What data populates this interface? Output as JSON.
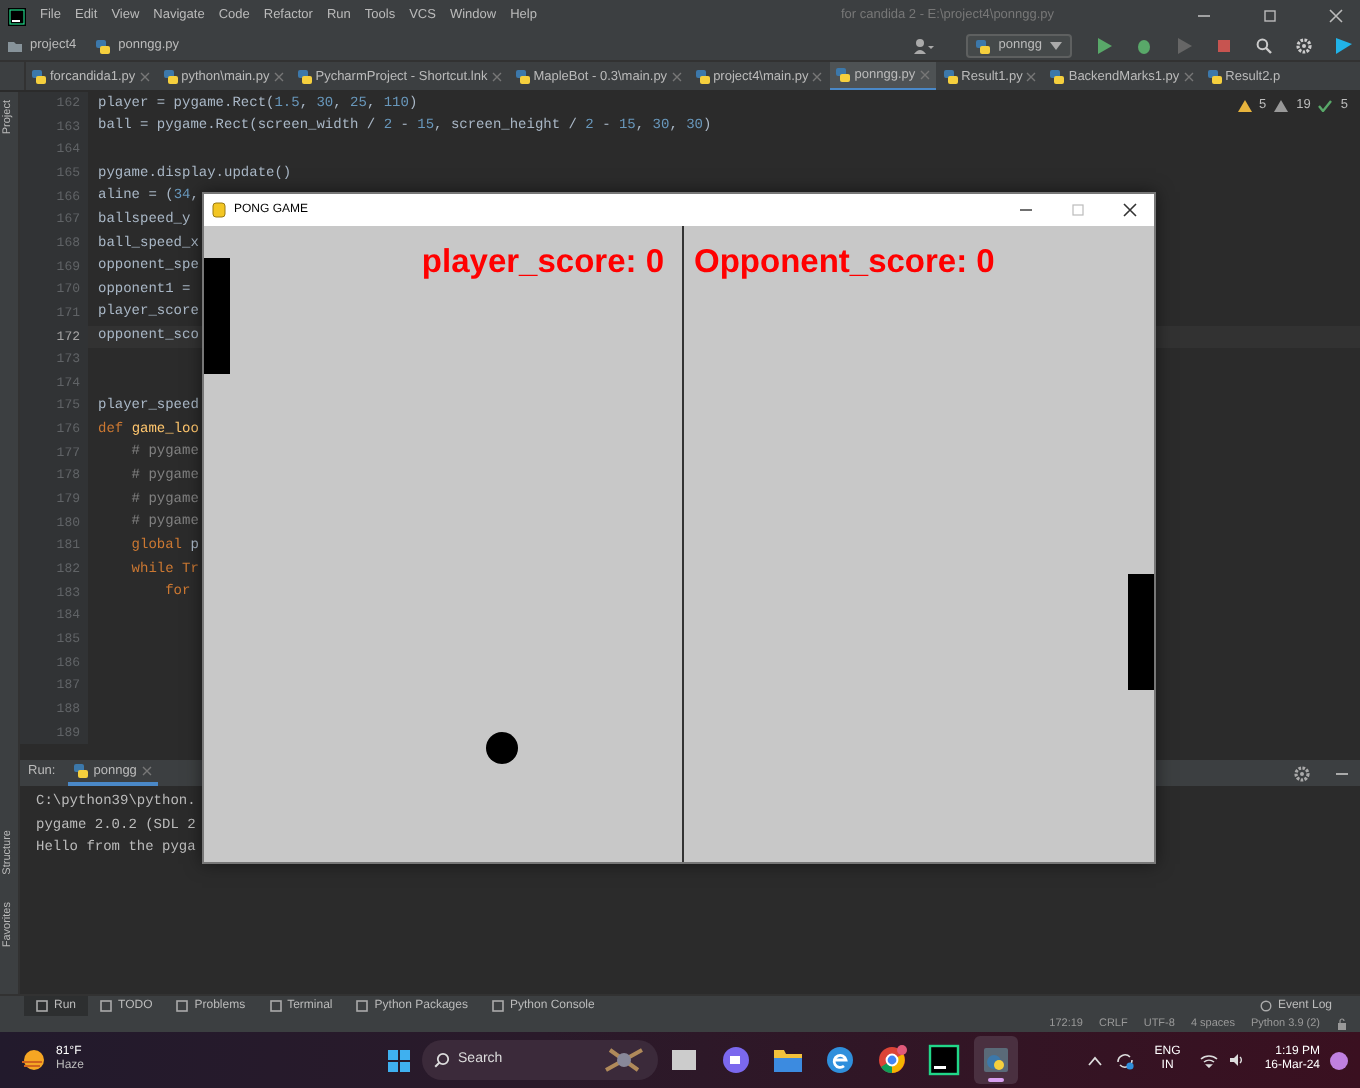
{
  "menu_bar": {
    "items": [
      "File",
      "Edit",
      "View",
      "Navigate",
      "Code",
      "Refactor",
      "Run",
      "Tools",
      "VCS",
      "Window",
      "Help"
    ],
    "title": "for candida 2 - E:\\project4\\ponngg.py"
  },
  "navigation_bar": {
    "breadcrumbs": [
      "project4",
      "ponngg.py"
    ],
    "run_configuration": "ponngg"
  },
  "editor_tabs": [
    {
      "label": "forcandida1.py",
      "selected": false
    },
    {
      "label": "python\\main.py",
      "selected": false
    },
    {
      "label": "PycharmProject - Shortcut.lnk",
      "selected": false
    },
    {
      "label": "MapleBot - 0.3\\main.py",
      "selected": false
    },
    {
      "label": "project4\\main.py",
      "selected": false
    },
    {
      "label": "ponngg.py",
      "selected": true
    },
    {
      "label": "Result1.py",
      "selected": false
    },
    {
      "label": "BackendMarks1.py",
      "selected": false
    },
    {
      "label": "Result2.p",
      "selected": false
    }
  ],
  "inspections": {
    "warnings": "5",
    "weak_warnings": "19",
    "ok": "5"
  },
  "editor": {
    "lines": [
      {
        "number": "162",
        "current": false,
        "tokens": [
          {
            "text": "player = pygame.Rect(",
            "kind": "plain"
          },
          {
            "text": "1.5",
            "kind": "number"
          },
          {
            "text": ", ",
            "kind": "plain"
          },
          {
            "text": "30",
            "kind": "number"
          },
          {
            "text": ", ",
            "kind": "plain"
          },
          {
            "text": "25",
            "kind": "number"
          },
          {
            "text": ", ",
            "kind": "plain"
          },
          {
            "text": "110",
            "kind": "number"
          },
          {
            "text": ")",
            "kind": "plain"
          }
        ]
      },
      {
        "number": "163",
        "current": false,
        "tokens": [
          {
            "text": "ball = pygame.Rect(screen_width / ",
            "kind": "plain"
          },
          {
            "text": "2",
            "kind": "number"
          },
          {
            "text": " - ",
            "kind": "plain"
          },
          {
            "text": "15",
            "kind": "number"
          },
          {
            "text": ", screen_height / ",
            "kind": "plain"
          },
          {
            "text": "2",
            "kind": "number"
          },
          {
            "text": " - ",
            "kind": "plain"
          },
          {
            "text": "15",
            "kind": "number"
          },
          {
            "text": ", ",
            "kind": "plain"
          },
          {
            "text": "30",
            "kind": "number"
          },
          {
            "text": ", ",
            "kind": "plain"
          },
          {
            "text": "30",
            "kind": "number"
          },
          {
            "text": ")",
            "kind": "plain"
          }
        ]
      },
      {
        "number": "164",
        "current": false
      },
      {
        "number": "165",
        "current": false,
        "tokens": [
          {
            "text": "pygame.display.update()",
            "kind": "plain"
          }
        ]
      },
      {
        "number": "166",
        "current": false,
        "tokens": [
          {
            "text": "aline = (",
            "kind": "plain"
          },
          {
            "text": "34",
            "kind": "number"
          },
          {
            "text": ",",
            "kind": "plain"
          }
        ]
      },
      {
        "number": "167",
        "current": false,
        "tokens": [
          {
            "text": "ballspeed_y",
            "kind": "plain"
          }
        ]
      },
      {
        "number": "168",
        "current": false,
        "tokens": [
          {
            "text": "ball_speed_x",
            "kind": "plain"
          }
        ]
      },
      {
        "number": "169",
        "current": false,
        "tokens": [
          {
            "text": "opponent_spe",
            "kind": "plain"
          }
        ]
      },
      {
        "number": "170",
        "current": false,
        "tokens": [
          {
            "text": "opponent1 =",
            "kind": "plain"
          }
        ]
      },
      {
        "number": "171",
        "current": false,
        "tokens": [
          {
            "text": "player_score",
            "kind": "plain"
          }
        ]
      },
      {
        "number": "172",
        "current": true,
        "tokens": [
          {
            "text": "opponent_sco",
            "kind": "plain"
          }
        ]
      },
      {
        "number": "173",
        "current": false
      },
      {
        "number": "174",
        "current": false
      },
      {
        "number": "175",
        "current": false,
        "tokens": [
          {
            "text": "player_speed",
            "kind": "plain"
          }
        ]
      },
      {
        "number": "176",
        "current": false,
        "tokens": [
          {
            "text": "def ",
            "kind": "keyword"
          },
          {
            "text": "game_loo",
            "kind": "function"
          }
        ]
      },
      {
        "number": "177",
        "current": false,
        "tokens": [
          {
            "text": "    # pygame",
            "kind": "comment"
          }
        ]
      },
      {
        "number": "178",
        "current": false,
        "tokens": [
          {
            "text": "    # pygame",
            "kind": "comment"
          }
        ]
      },
      {
        "number": "179",
        "current": false,
        "tokens": [
          {
            "text": "    # pygame",
            "kind": "comment"
          }
        ]
      },
      {
        "number": "180",
        "current": false,
        "tokens": [
          {
            "text": "    # pygame",
            "kind": "comment"
          }
        ]
      },
      {
        "number": "181",
        "current": false,
        "tokens": [
          {
            "text": "    global ",
            "kind": "keyword"
          },
          {
            "text": "p",
            "kind": "plain"
          }
        ]
      },
      {
        "number": "182",
        "current": false,
        "tokens": [
          {
            "text": "    while Tr",
            "kind": "keyword"
          }
        ]
      },
      {
        "number": "183",
        "current": false,
        "tokens": [
          {
            "text": "        for",
            "kind": "keyword"
          }
        ]
      },
      {
        "number": "184",
        "current": false
      },
      {
        "number": "185",
        "current": false
      },
      {
        "number": "186",
        "current": false
      },
      {
        "number": "187",
        "current": false
      },
      {
        "number": "188",
        "current": false
      },
      {
        "number": "189",
        "current": false
      }
    ]
  },
  "side_tabs": [
    "Project",
    "Structure",
    "Favorites"
  ],
  "run_panel": {
    "label": "Run:",
    "tabs": [
      {
        "label": "ponngg",
        "selected": true
      }
    ],
    "console": [
      "C:\\python39\\python.",
      "pygame 2.0.2 (SDL 2",
      "Hello from the pyga"
    ]
  },
  "tool_window_bar": {
    "items": [
      {
        "label": "Run",
        "selected": true
      },
      {
        "label": "TODO",
        "selected": false
      },
      {
        "label": "Problems",
        "selected": false
      },
      {
        "label": "Terminal",
        "selected": false
      },
      {
        "label": "Python Packages",
        "selected": false
      },
      {
        "label": "Python Console",
        "selected": false
      }
    ],
    "event_log": "Event Log"
  },
  "status_bar": [
    "172:19",
    "CRLF",
    "UTF-8",
    "4 spaces",
    "Python 3.9 (2)"
  ],
  "game_window": {
    "title": "PONG GAME",
    "player_score": "player_score: 0",
    "opponent_score": "Opponent_score: 0"
  },
  "taskbar": {
    "weather": {
      "temperature": "81°F",
      "condition": "Haze"
    },
    "search": {
      "placeholder": "Search"
    },
    "apps": [
      {
        "kind": "window",
        "selected": false
      },
      {
        "kind": "meet",
        "selected": false
      },
      {
        "kind": "folder",
        "selected": false
      },
      {
        "kind": "edge",
        "selected": false
      },
      {
        "kind": "chrome",
        "selected": false
      },
      {
        "kind": "pycharm",
        "selected": false
      },
      {
        "kind": "python",
        "selected": true
      }
    ],
    "tray": {
      "language": "ENG",
      "region": "IN",
      "time": "1:19 PM",
      "date": "16-Mar-24"
    }
  }
}
